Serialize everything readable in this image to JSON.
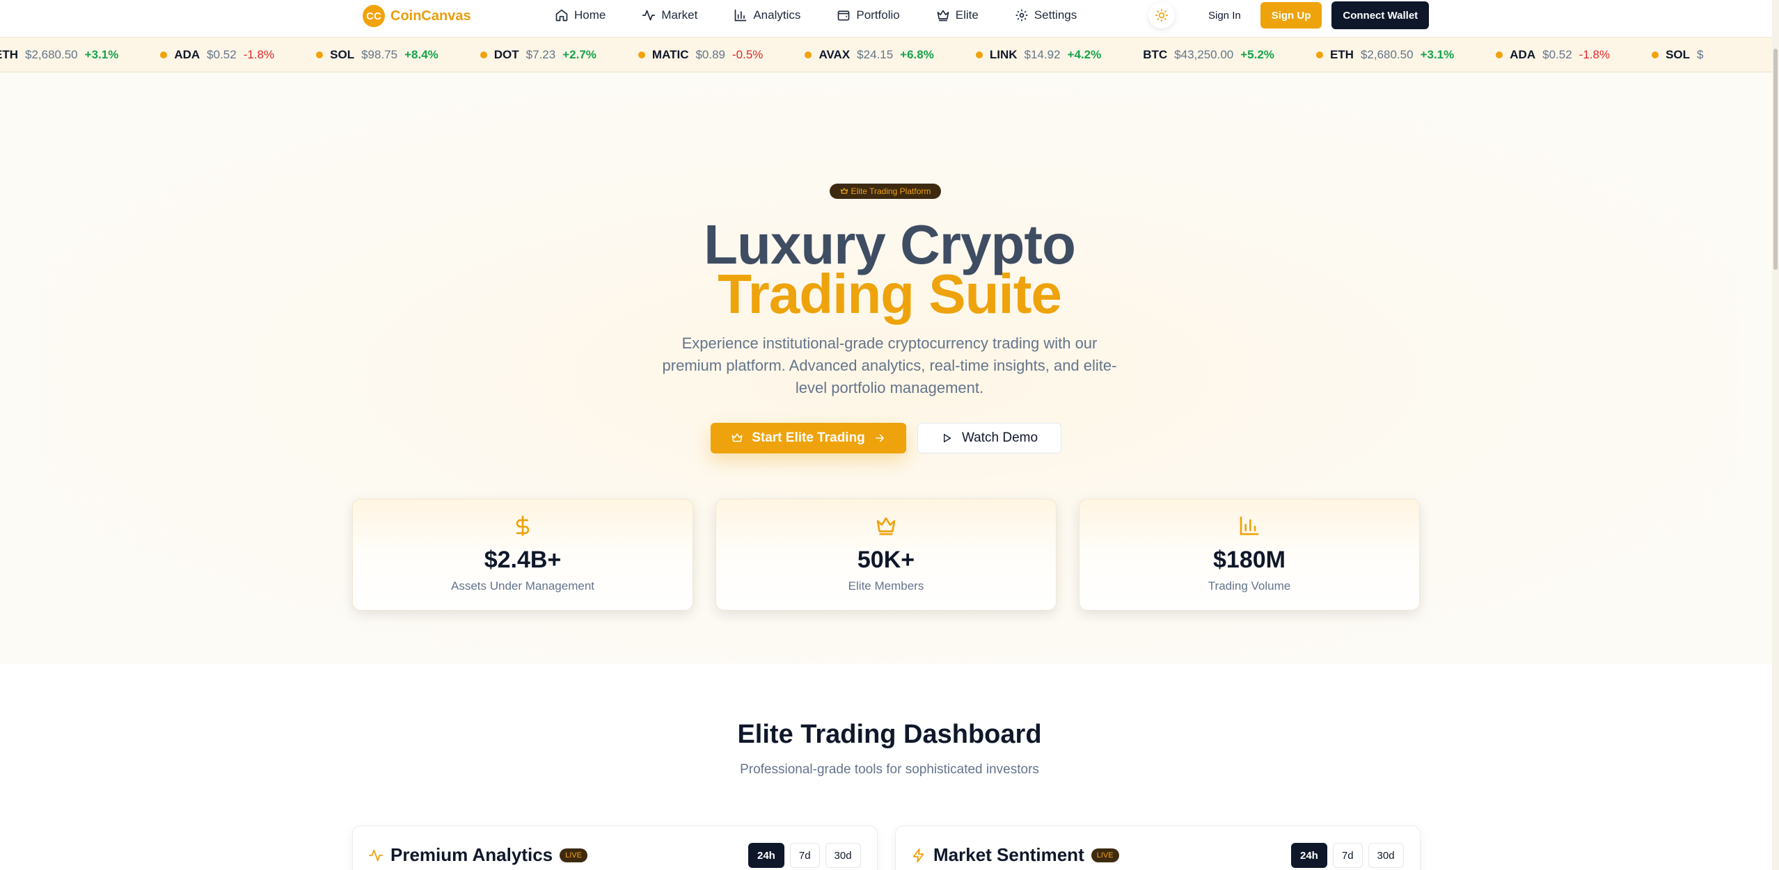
{
  "brand": {
    "logo": "CC",
    "name": "CoinCanvas"
  },
  "nav": {
    "links": [
      {
        "label": "Home",
        "icon": "home-icon"
      },
      {
        "label": "Market",
        "icon": "activity-icon"
      },
      {
        "label": "Analytics",
        "icon": "bar-chart-icon"
      },
      {
        "label": "Portfolio",
        "icon": "wallet-icon"
      },
      {
        "label": "Elite",
        "icon": "crown-icon"
      },
      {
        "label": "Settings",
        "icon": "gear-icon"
      }
    ],
    "theme_icon": "sun-icon",
    "sign_in": "Sign In",
    "sign_up": "Sign Up",
    "connect_wallet": "Connect Wallet"
  },
  "ticker": [
    {
      "symbol": "ETH",
      "price": "$2,680.50",
      "change": "+3.1%",
      "dir": "up",
      "show_dot": false
    },
    {
      "symbol": "ADA",
      "price": "$0.52",
      "change": "-1.8%",
      "dir": "down",
      "show_dot": true
    },
    {
      "symbol": "SOL",
      "price": "$98.75",
      "change": "+8.4%",
      "dir": "up",
      "show_dot": true
    },
    {
      "symbol": "DOT",
      "price": "$7.23",
      "change": "+2.7%",
      "dir": "up",
      "show_dot": true
    },
    {
      "symbol": "MATIC",
      "price": "$0.89",
      "change": "-0.5%",
      "dir": "down",
      "show_dot": true
    },
    {
      "symbol": "AVAX",
      "price": "$24.15",
      "change": "+6.8%",
      "dir": "up",
      "show_dot": true
    },
    {
      "symbol": "LINK",
      "price": "$14.92",
      "change": "+4.2%",
      "dir": "up",
      "show_dot": true
    },
    {
      "symbol": "BTC",
      "price": "$43,250.00",
      "change": "+5.2%",
      "dir": "up",
      "show_dot": false
    },
    {
      "symbol": "ETH",
      "price": "$2,680.50",
      "change": "+3.1%",
      "dir": "up",
      "show_dot": true
    },
    {
      "symbol": "ADA",
      "price": "$0.52",
      "change": "-1.8%",
      "dir": "down",
      "show_dot": true
    },
    {
      "symbol": "SOL",
      "price": "$",
      "change": "",
      "dir": "up",
      "show_dot": true
    }
  ],
  "hero": {
    "badge": "Elite Trading Platform",
    "title_line1": "Luxury Crypto",
    "title_line2": "Trading Suite",
    "subtitle": "Experience institutional-grade cryptocurrency trading with our premium platform. Advanced analytics, real-time insights, and elite-level portfolio management.",
    "cta_primary": "Start Elite Trading",
    "cta_secondary": "Watch Demo"
  },
  "stats": [
    {
      "icon": "dollar-icon",
      "value": "$2.4B+",
      "label": "Assets Under Management"
    },
    {
      "icon": "crown-icon",
      "value": "50K+",
      "label": "Elite Members"
    },
    {
      "icon": "bar-chart-icon",
      "value": "$180M",
      "label": "Trading Volume"
    }
  ],
  "dashboard": {
    "title": "Elite Trading Dashboard",
    "subtitle": "Professional-grade tools for sophisticated investors",
    "panels": [
      {
        "title": "Premium Analytics",
        "icon": "activity-icon",
        "badge": "LIVE",
        "ranges": [
          "24h",
          "7d",
          "30d"
        ],
        "active_range": "24h"
      },
      {
        "title": "Market Sentiment",
        "icon": "zap-icon",
        "badge": "LIVE",
        "ranges": [
          "24h",
          "7d",
          "30d"
        ],
        "active_range": "24h"
      }
    ]
  },
  "colors": {
    "accent": "#eea30c",
    "dark": "#0f172a",
    "up": "#16a34a",
    "down": "#dc2626"
  }
}
